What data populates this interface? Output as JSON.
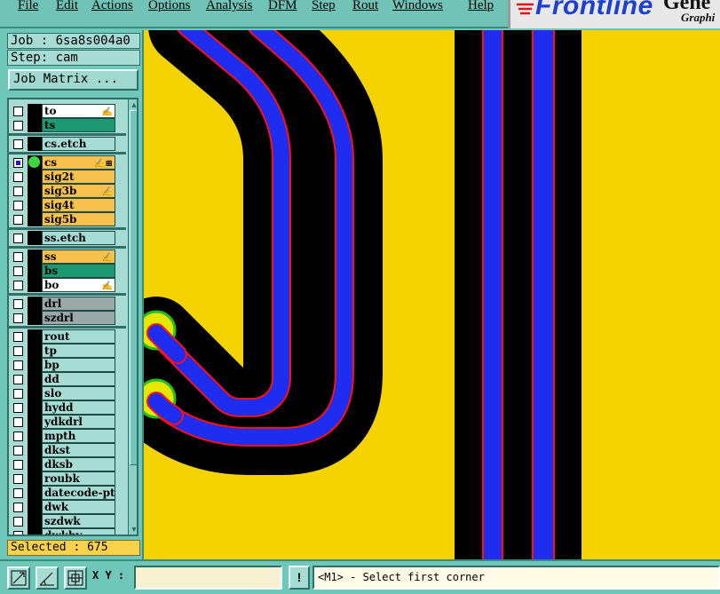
{
  "menu": [
    {
      "label": "File",
      "name": "menu-file"
    },
    {
      "label": "Edit",
      "name": "menu-edit"
    },
    {
      "label": "Actions",
      "name": "menu-actions"
    },
    {
      "label": "Options",
      "name": "menu-options"
    },
    {
      "label": "Analysis",
      "name": "menu-analysis"
    },
    {
      "label": "DFM",
      "name": "menu-dfm"
    },
    {
      "label": "Step",
      "name": "menu-step"
    },
    {
      "label": "Rout",
      "name": "menu-rout"
    },
    {
      "label": "Windows",
      "name": "menu-windows"
    },
    {
      "label": "Help",
      "name": "menu-help"
    }
  ],
  "logo": {
    "brand": "Frontline",
    "text2": "Gene",
    "sub": "Graphi"
  },
  "job": "Job : 6sa8s004a0",
  "step": "Step: cam",
  "job_matrix_button": "Job Matrix ...",
  "layers": [
    {
      "name": "to",
      "color": "#ffffff",
      "mark": "✍"
    },
    {
      "name": "ts",
      "color": "#1d9a72",
      "mark": ""
    },
    {
      "name": "cs.etch",
      "color": "#a6dcd4",
      "mark": ""
    },
    {
      "name": "cs",
      "color": "#f8c04c",
      "mark": "✍",
      "mark2": "⊞",
      "work": true,
      "checked": true
    },
    {
      "name": "sig2t",
      "color": "#f8c04c",
      "mark": ""
    },
    {
      "name": "sig3b",
      "color": "#f8c04c",
      "mark": "✍"
    },
    {
      "name": "sig4t",
      "color": "#f8c04c",
      "mark": ""
    },
    {
      "name": "sig5b",
      "color": "#f8c04c",
      "mark": ""
    },
    {
      "name": "ss.etch",
      "color": "#a6dcd4",
      "mark": ""
    },
    {
      "name": "ss",
      "color": "#f8c04c",
      "mark": "✍"
    },
    {
      "name": "bs",
      "color": "#1d9a72",
      "mark": ""
    },
    {
      "name": "bo",
      "color": "#ffffff",
      "mark": "✍"
    },
    {
      "name": "drl",
      "color": "#9aa8a8",
      "mark": ""
    },
    {
      "name": "szdrl",
      "color": "#9aa8a8",
      "mark": ""
    },
    {
      "name": "rout",
      "color": "#a6dcd4",
      "mark": ""
    },
    {
      "name": "tp",
      "color": "#a6dcd4",
      "mark": ""
    },
    {
      "name": "bp",
      "color": "#a6dcd4",
      "mark": ""
    },
    {
      "name": "dd",
      "color": "#a6dcd4",
      "mark": ""
    },
    {
      "name": "slo",
      "color": "#a6dcd4",
      "mark": ""
    },
    {
      "name": "hydd",
      "color": "#a6dcd4",
      "mark": ""
    },
    {
      "name": "ydkdrl",
      "color": "#a6dcd4",
      "mark": ""
    },
    {
      "name": "mpth",
      "color": "#a6dcd4",
      "mark": ""
    },
    {
      "name": "dkst",
      "color": "#a6dcd4",
      "mark": ""
    },
    {
      "name": "dksb",
      "color": "#a6dcd4",
      "mark": ""
    },
    {
      "name": "roubk",
      "color": "#a6dcd4",
      "mark": ""
    },
    {
      "name": "datecode-pte",
      "color": "#a6dcd4",
      "mark": ""
    },
    {
      "name": "dwk",
      "color": "#a6dcd4",
      "mark": ""
    },
    {
      "name": "szdwk",
      "color": "#a6dcd4",
      "mark": ""
    },
    {
      "name": "dwkbv",
      "color": "#a6dcd4",
      "mark": ""
    }
  ],
  "selected": "Selected : 675",
  "xy_label": "X Y :",
  "xy_value": "",
  "excl_label": "!",
  "status_message": "<M1> - Select first corner",
  "colors": {
    "background": "#f5d300",
    "trace_keepout": "#000000",
    "trace_copper": "#1f2df0",
    "trace_outline": "#ff1010",
    "pad": "#e6e600",
    "pad_outline": "#22c022"
  }
}
